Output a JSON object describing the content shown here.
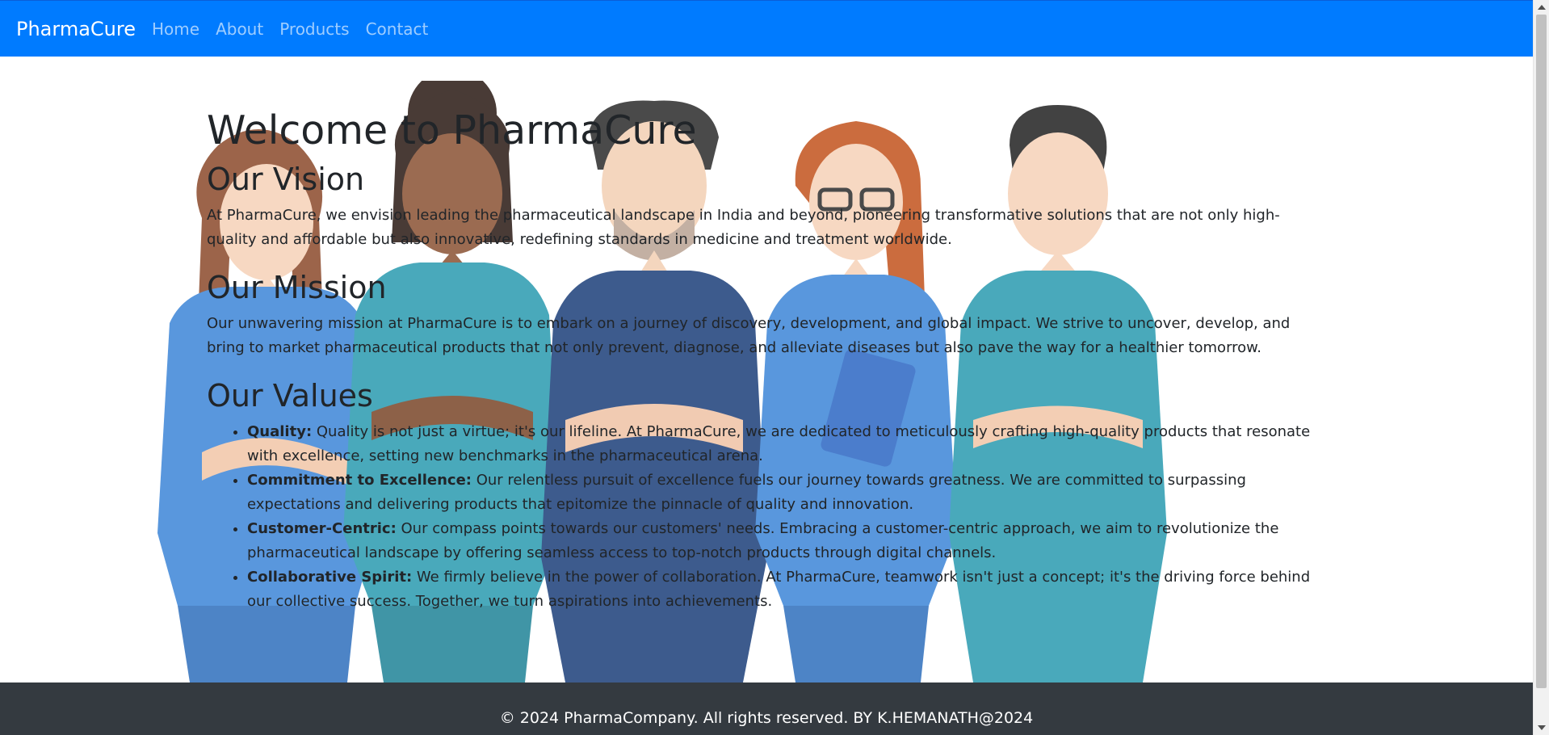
{
  "navbar": {
    "brand": "PharmaCure",
    "links": [
      "Home",
      "About",
      "Products",
      "Contact"
    ],
    "color": "#007bff"
  },
  "hero": {
    "image": "five-healthcare-workers-illustration"
  },
  "main": {
    "welcome": "Welcome to PharmaCure",
    "vision": {
      "title": "Our Vision",
      "text": "At PharmaCure, we envision leading the pharmaceutical landscape in India and beyond, pioneering transformative solutions that are not only high-quality and affordable but also innovative, redefining standards in medicine and treatment worldwide."
    },
    "mission": {
      "title": "Our Mission",
      "text": "Our unwavering mission at PharmaCure is to embark on a journey of discovery, development, and global impact. We strive to uncover, develop, and bring to market pharmaceutical products that not only prevent, diagnose, and alleviate diseases but also pave the way for a healthier tomorrow."
    },
    "values": {
      "title": "Our Values",
      "items": [
        {
          "name": "Quality:",
          "text": " Quality is not just a virtue; it's our lifeline. At PharmaCure, we are dedicated to meticulously crafting high-quality products that resonate with excellence, setting new benchmarks in the pharmaceutical arena."
        },
        {
          "name": "Commitment to Excellence:",
          "text": " Our relentless pursuit of excellence fuels our journey towards greatness. We are committed to surpassing expectations and delivering products that epitomize the pinnacle of quality and innovation."
        },
        {
          "name": "Customer-Centric:",
          "text": " Our compass points towards our customers' needs. Embracing a customer-centric approach, we aim to revolutionize the pharmaceutical landscape by offering seamless access to top-notch products through digital channels."
        },
        {
          "name": "Collaborative Spirit:",
          "text": " We firmly believe in the power of collaboration. At PharmaCure, teamwork isn't just a concept; it's the driving force behind our collective success. Together, we turn aspirations into achievements."
        }
      ]
    }
  },
  "footer": {
    "text": "© 2024 PharmaCompany. All rights reserved. BY K.HEMANATH@2024",
    "color": "#343a40"
  }
}
